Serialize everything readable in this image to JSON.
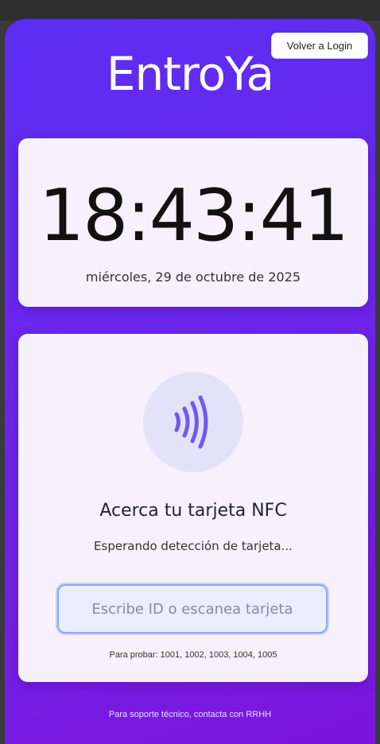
{
  "header": {
    "login_button": "Volver a Login",
    "app_title": "EntroYa"
  },
  "clock": {
    "time": "18:43:41",
    "date": "miércoles, 29 de octubre de 2025"
  },
  "nfc": {
    "icon": "nfc-waves-icon",
    "title": "Acerca tu tarjeta NFC",
    "status": "Esperando detección de tarjeta...",
    "input_placeholder": "Escribe ID o escanea tarjeta",
    "input_value": "",
    "hint": "Para probar: 1001, 1002, 1003, 1004, 1005"
  },
  "footer": {
    "text": "Para soporte técnico, contacta con RRHH"
  },
  "colors": {
    "gradient_start": "#5a2ff2",
    "gradient_end": "#7d15dc",
    "card_bg": "#f6f1fc",
    "nfc_icon": "#6f5af0",
    "input_border": "#8fa6f3"
  }
}
